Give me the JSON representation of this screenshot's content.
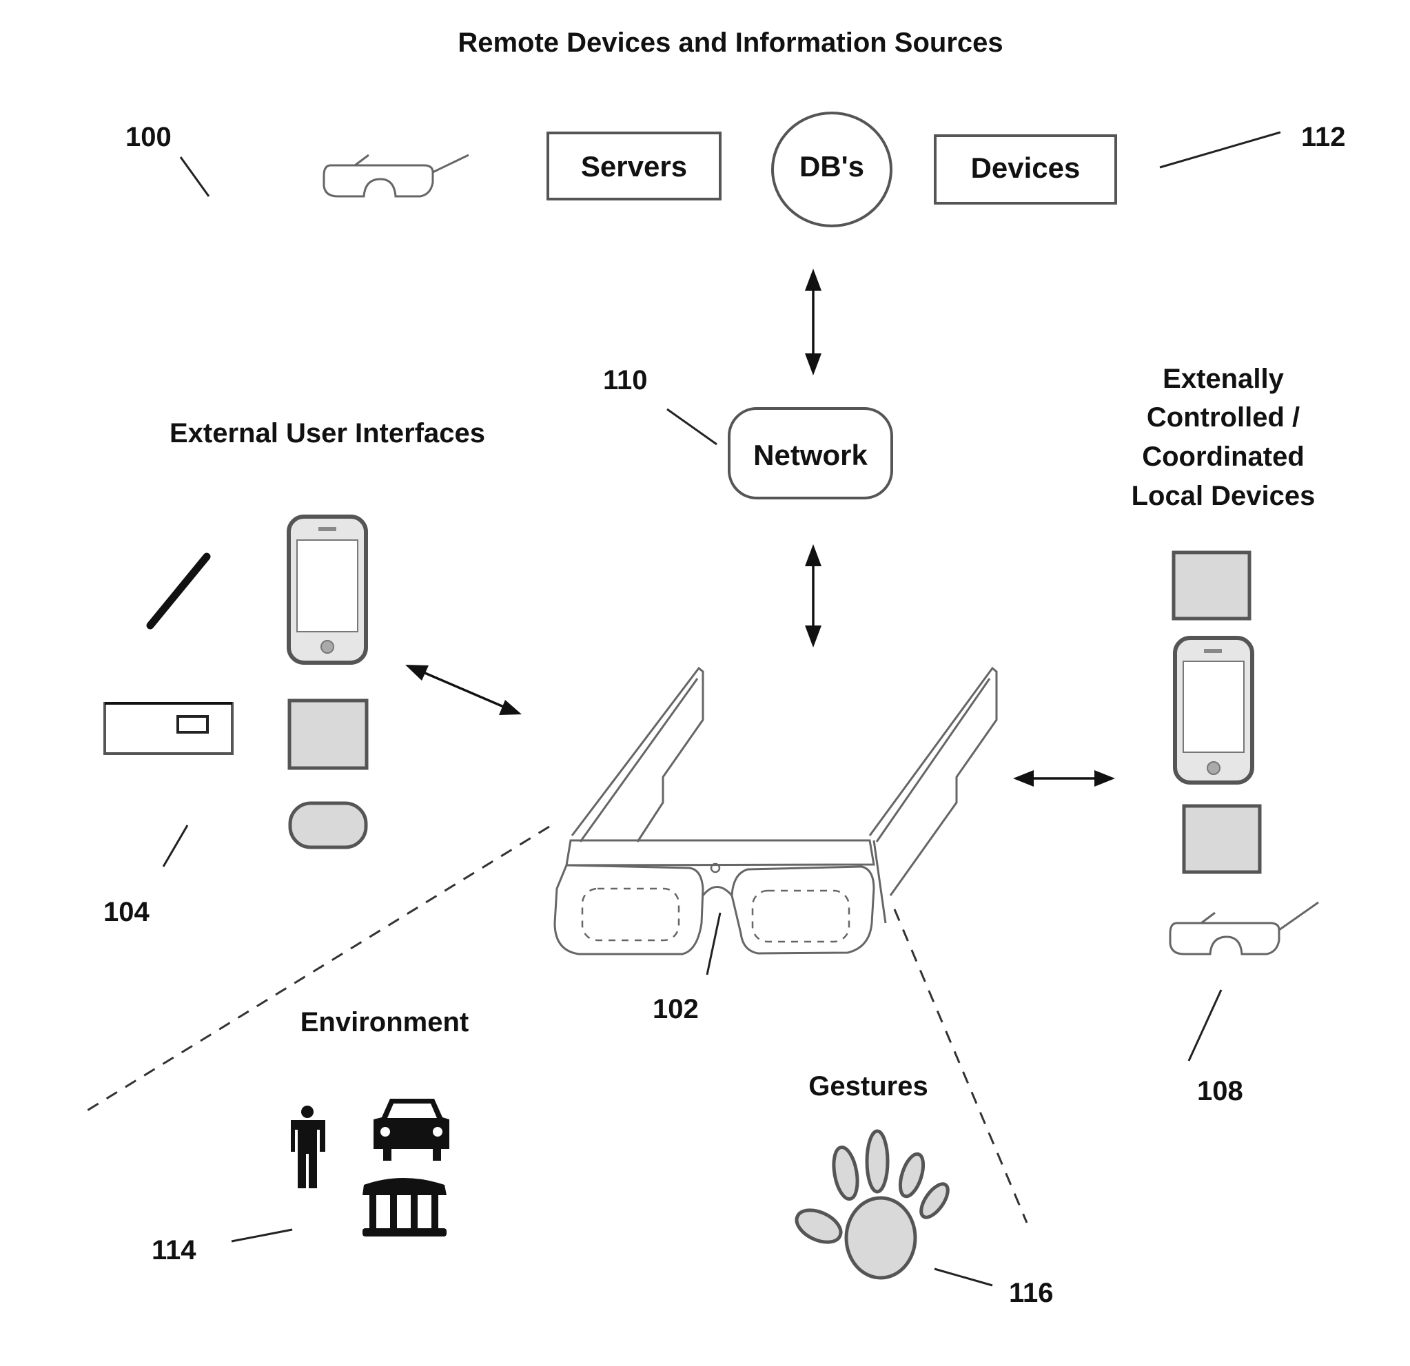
{
  "diagram": {
    "title": "Remote Devices and Information Sources",
    "remote": {
      "servers_label": "Servers",
      "dbs_label": "DB's",
      "devices_label": "Devices"
    },
    "network_label": "Network",
    "sections": {
      "external_ui": "External User Interfaces",
      "local_devices_lines": [
        "Extenally",
        "Controlled /",
        "Coordinated",
        "Local Devices"
      ],
      "environment": "Environment",
      "gestures": "Gestures"
    },
    "refs": {
      "r100": "100",
      "r102": "102",
      "r104": "104",
      "r108": "108",
      "r110": "110",
      "r112": "112",
      "r114": "114",
      "r116": "116"
    },
    "icons": {
      "remote_glasses": "glasses-icon",
      "stylus": "stylus-icon",
      "phone": "smartphone-icon",
      "keyboard": "keyboard-icon",
      "tablet": "tablet-icon",
      "wearable": "wearable-icon",
      "person": "person-icon",
      "car": "car-icon",
      "building": "building-icon",
      "hand": "hand-icon",
      "hmd": "head-mounted-display-icon"
    }
  }
}
